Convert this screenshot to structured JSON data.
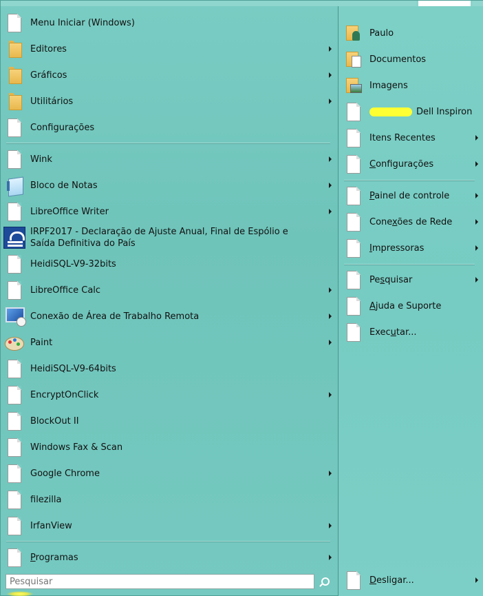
{
  "left_menu": {
    "items": [
      {
        "label": "Menu Iniciar (Windows)",
        "icon": "document-icon",
        "arrow": false
      },
      {
        "label": "Editores",
        "icon": "folder-icon",
        "arrow": true
      },
      {
        "label": "Gráficos",
        "icon": "folder-icon",
        "arrow": true
      },
      {
        "label": "Utilitários",
        "icon": "folder-icon",
        "arrow": true
      },
      {
        "label": "Configurações",
        "icon": "document-icon",
        "arrow": false
      },
      {
        "label": "Wink",
        "icon": "document-icon",
        "arrow": true
      },
      {
        "label": "Bloco de Notas",
        "icon": "notepad-icon",
        "arrow": true
      },
      {
        "label": "LibreOffice Writer",
        "icon": "document-icon",
        "arrow": true
      },
      {
        "label": "IRPF2017 - Declaração de Ajuste Anual, Final de Espólio e Saída Definitiva do País",
        "icon": "irpf-icon",
        "arrow": false
      },
      {
        "label": "HeidiSQL-V9-32bits",
        "icon": "document-icon",
        "arrow": false
      },
      {
        "label": "LibreOffice Calc",
        "icon": "document-icon",
        "arrow": true
      },
      {
        "label": "Conexão de Área de Trabalho Remota",
        "icon": "remote-desktop-icon",
        "arrow": true
      },
      {
        "label": "Paint",
        "icon": "paint-icon",
        "arrow": true
      },
      {
        "label": "HeidiSQL-V9-64bits",
        "icon": "document-icon",
        "arrow": false
      },
      {
        "label": "EncryptOnClick",
        "icon": "document-icon",
        "arrow": true
      },
      {
        "label": "BlockOut II",
        "icon": "document-icon",
        "arrow": false
      },
      {
        "label": "Windows Fax & Scan",
        "icon": "document-icon",
        "arrow": false
      },
      {
        "label": "Google Chrome",
        "icon": "document-icon",
        "arrow": true
      },
      {
        "label": "filezilla",
        "icon": "document-icon",
        "arrow": false
      },
      {
        "label": "IrfanView",
        "icon": "document-icon",
        "arrow": true
      }
    ],
    "programs": {
      "accel": "P",
      "rest": "rogramas"
    }
  },
  "search": {
    "placeholder": "Pesquisar"
  },
  "right_menu": {
    "paulo": "Paulo",
    "documentos": "Documentos",
    "imagens": "Imagens",
    "computer_suffix": "Dell Inspiron",
    "itens_recentes": "Itens Recentes",
    "configuracoes": {
      "accel": "C",
      "rest": "onfigurações"
    },
    "painel": {
      "accel": "P",
      "rest": "ainel de controle"
    },
    "conexoes": {
      "pre": "Cone",
      "accel": "x",
      "rest": "ões de Rede"
    },
    "impressoras": {
      "accel": "I",
      "rest": "mpressoras"
    },
    "pesquisar": {
      "pre": "Pe",
      "accel": "s",
      "rest": "quisar"
    },
    "ajuda": {
      "accel": "A",
      "rest": "juda e Suporte"
    },
    "executar": {
      "pre": "Exec",
      "accel": "u",
      "rest": "tar..."
    },
    "desligar": {
      "accel": "D",
      "rest": "esligar..."
    }
  }
}
